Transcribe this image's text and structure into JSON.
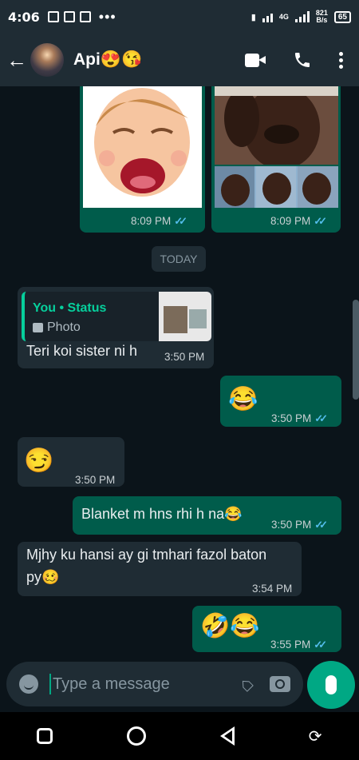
{
  "status": {
    "time": "4:06",
    "network_type": "4G",
    "speed_value": "821",
    "speed_unit": "B/s",
    "battery": "65"
  },
  "header": {
    "contact_name": "Api😍😘"
  },
  "messages": {
    "img1_time": "8:09 PM",
    "img2_time": "8:09 PM",
    "date_label": "TODAY",
    "reply_quote_author": "You • Status",
    "reply_quote_type": "Photo",
    "msg1_text": "Teri koi sister ni h",
    "msg1_time": "3:50 PM",
    "msg2_emoji": "😂",
    "msg2_time": "3:50 PM",
    "msg3_emoji": "😏",
    "msg3_time": "3:50 PM",
    "msg4_text": "Blanket m hns rhi h na😂",
    "msg4_time": "3:50 PM",
    "msg5_text_line1": "Mjhy ku hansi ay gi tmhari fazol baton",
    "msg5_text_line2": "py🥴",
    "msg5_time": "3:54 PM",
    "msg6_emoji": "🤣😂",
    "msg6_time": "3:55 PM"
  },
  "composer": {
    "placeholder": "Type a message"
  },
  "colors": {
    "incoming": "#1f2c34",
    "outgoing": "#005c4b",
    "accent": "#00a884",
    "read_tick": "#53bdeb"
  },
  "icons": [
    "back-arrow-icon",
    "video-call-icon",
    "phone-icon",
    "more-options-icon",
    "emoji-icon",
    "attach-icon",
    "camera-icon",
    "mic-icon",
    "double-tick-icon"
  ]
}
